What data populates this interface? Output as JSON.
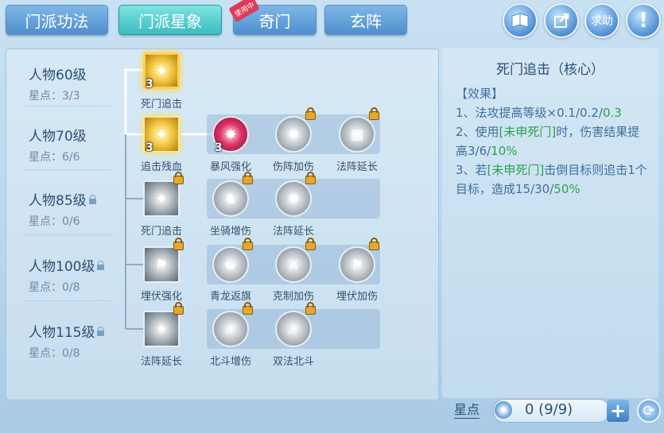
{
  "tabs": [
    {
      "label": "门派功法",
      "state": "normal"
    },
    {
      "label": "门派星象",
      "state": "active"
    },
    {
      "label": "奇门",
      "state": "normal",
      "badge": "使用中"
    },
    {
      "label": "玄阵",
      "state": "normal"
    }
  ],
  "top_icons": [
    "book-icon",
    "share-icon",
    "help-text-icon",
    "alert-icon"
  ],
  "help_label": "求助",
  "levels": [
    {
      "label": "人物60级",
      "stars": "星点：3/3",
      "locked": false
    },
    {
      "label": "人物70级",
      "stars": "星点：6/6",
      "locked": false
    },
    {
      "label": "人物85级",
      "stars": "星点：0/6",
      "locked": true
    },
    {
      "label": "人物100级",
      "stars": "星点：0/8",
      "locked": true
    },
    {
      "label": "人物115级",
      "stars": "星点：0/8",
      "locked": true
    }
  ],
  "skills": {
    "r1": [
      {
        "label": "死门追击",
        "count": "3"
      }
    ],
    "r2": [
      {
        "label": "追击残血",
        "count": "3"
      },
      {
        "label": "暴风强化",
        "count": "3"
      },
      {
        "label": "伤阵加伤"
      },
      {
        "label": "法阵延长"
      }
    ],
    "r3": [
      {
        "label": "死门追击"
      },
      {
        "label": "坐骑增伤"
      },
      {
        "label": "法阵延长"
      }
    ],
    "r4": [
      {
        "label": "埋伏强化"
      },
      {
        "label": "青龙返旗"
      },
      {
        "label": "克制加伤"
      },
      {
        "label": "埋伏加伤"
      }
    ],
    "r5": [
      {
        "label": "法阵延长"
      },
      {
        "label": "北斗增伤"
      },
      {
        "label": "双法北斗"
      }
    ]
  },
  "detail": {
    "title": "死门追击（核心）",
    "effect_header": "【效果】",
    "line1a": "1、法攻提高等级×0.1/0.2/",
    "line1b": "0.3",
    "line2a": "2、使用",
    "line2b": "[未申死门]",
    "line2c": "时，伤害结果提高3/6/",
    "line2d": "10%",
    "line3a": "3、若",
    "line3b": "[未申死门]",
    "line3c": "击倒目标则追击1个目标，造成15/30/",
    "line3d": "50%"
  },
  "bottom": {
    "label": "星点",
    "value": "0 (9/9)"
  },
  "colors": {
    "accent_green": "#2aa24a",
    "text_blue": "#3f6f9c"
  }
}
